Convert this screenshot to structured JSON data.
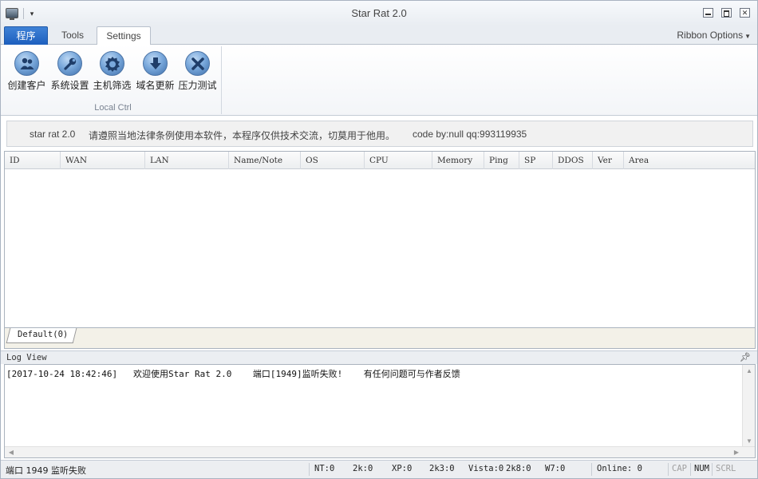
{
  "window": {
    "title": "Star Rat 2.0"
  },
  "tabs": {
    "program": "程序",
    "tools": "Tools",
    "settings": "Settings"
  },
  "ribbon_options": "Ribbon Options",
  "ribbon": {
    "group_label": "Local Ctrl",
    "buttons": [
      {
        "label": "创建客户",
        "icon": "users-icon"
      },
      {
        "label": "系统设置",
        "icon": "wrench-icon"
      },
      {
        "label": "主机筛选",
        "icon": "filter-badge-icon"
      },
      {
        "label": "域名更新",
        "icon": "download-arrow-icon"
      },
      {
        "label": "压力测试",
        "icon": "close-x-icon"
      }
    ]
  },
  "info_bar": {
    "app": "star rat 2.0",
    "disclaimer": "请遵照当地法律条例使用本软件，本程序仅供技术交流，切莫用于他用。",
    "code": "code by:null qq:993119935"
  },
  "table": {
    "columns": [
      "ID",
      "WAN",
      "LAN",
      "Name/Note",
      "OS",
      "CPU",
      "Memory",
      "Ping",
      "SP",
      "DDOS",
      "Ver",
      "Area"
    ],
    "rows": []
  },
  "group_tab": "Default(0)",
  "log": {
    "title": "Log View",
    "line": "[2017-10-24 18:42:46]   欢迎使用Star Rat 2.0    端口[1949]监听失败!    有任何问题可与作者反馈"
  },
  "status": {
    "message": "端口 1949 监听失败",
    "nt": "NT:0",
    "k2": "2k:0",
    "xp": "XP:0",
    "k2k3": "2k3:0",
    "vista": "Vista:0",
    "k2k8": "2k8:0",
    "w7": "W7:0",
    "online": "Online: 0",
    "cap": "CAP",
    "num": "NUM",
    "scrl": "SCRL"
  }
}
